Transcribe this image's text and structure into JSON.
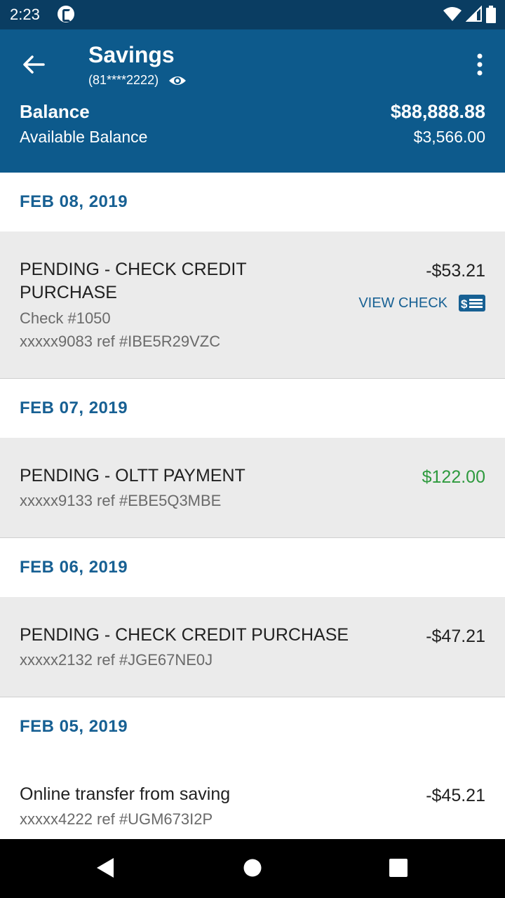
{
  "status_bar": {
    "time": "2:23"
  },
  "header": {
    "title": "Savings",
    "account_masked": "(81****2222)",
    "balance_label": "Balance",
    "balance_value": "$88,888.88",
    "available_label": "Available Balance",
    "available_value": "$3,566.00"
  },
  "groups": [
    {
      "date": "FEB 08, 2019",
      "transaction": {
        "description": "PENDING - CHECK CREDIT PURCHASE",
        "check_number": "Check #1050",
        "reference": "xxxxx9083 ref #IBE5R29VZC",
        "amount": "-$53.21",
        "action": "VIEW CHECK"
      }
    },
    {
      "date": "FEB 07, 2019",
      "transaction": {
        "description": "PENDING - OLTT PAYMENT",
        "reference": "xxxxx9133 ref #EBE5Q3MBE",
        "amount": "$122.00"
      }
    },
    {
      "date": "FEB 06, 2019",
      "transaction": {
        "description": "PENDING - CHECK CREDIT PURCHASE",
        "reference": "xxxxx2132 ref #JGE67NE0J",
        "amount": "-$47.21"
      }
    },
    {
      "date": "FEB 05, 2019",
      "transaction": {
        "description": "Online transfer from saving",
        "reference": "xxxxx4222 ref #UGM673I2P",
        "amount": "-$45.21"
      }
    }
  ],
  "colors": {
    "header": "#0d5a8c",
    "status_bar": "#0a3d62",
    "accent": "#176093",
    "credit": "#2e9a3e"
  },
  "icons": [
    "back-arrow-icon",
    "eye-icon",
    "more-vert-icon",
    "check-image-icon",
    "wifi-icon",
    "signal-icon",
    "battery-icon",
    "nav-back-icon",
    "nav-home-icon",
    "nav-recents-icon"
  ]
}
